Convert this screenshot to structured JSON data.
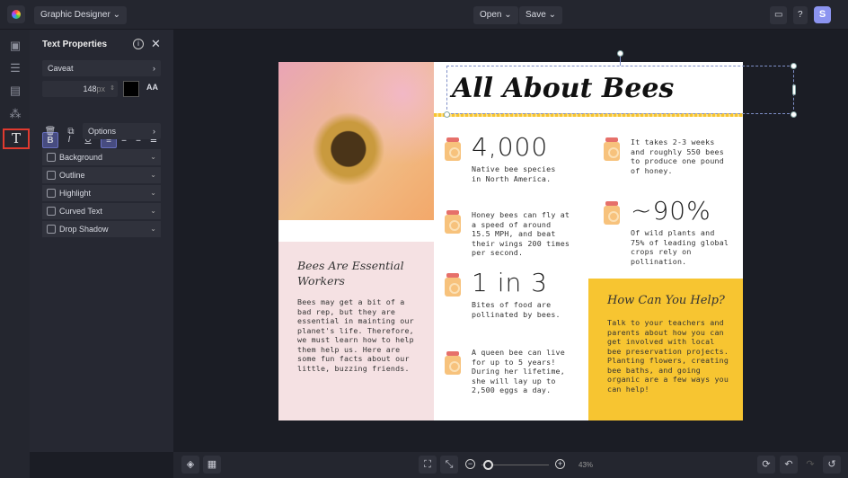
{
  "topbar": {
    "project": "Graphic Designer",
    "open": "Open",
    "save": "Save",
    "avatar": "S"
  },
  "panel": {
    "title": "Text Properties",
    "font": "Caveat",
    "size": "148",
    "unit": "px",
    "options": "Options",
    "accordions": [
      "Background",
      "Outline",
      "Highlight",
      "Curved Text",
      "Drop Shadow"
    ]
  },
  "design": {
    "title": "All About Bees",
    "stats": [
      {
        "big": "4,000",
        "text": "Native bee species in North America."
      },
      {
        "big": "",
        "text": "It takes 2-3 weeks and roughly 550 bees to produce one pound of honey."
      },
      {
        "big": "",
        "text": "Honey bees can fly at a speed of around 15.5 MPH, and beat their wings 200 times per second."
      },
      {
        "big": "~90%",
        "text": "Of wild plants and 75% of leading global crops rely on pollination."
      },
      {
        "big": "1 in 3",
        "text": "Bites of food are pollinated by bees."
      },
      {
        "big": "",
        "text": "A queen bee can live for up to 5 years! During her lifetime, she will lay up to 2,500 eggs a day."
      }
    ],
    "pink": {
      "heading": "Bees Are Essential Workers",
      "body": "Bees may get a bit of a bad rep, but they are essential in mainting our planet's life. Therefore, we must learn how to help them help us. Here are some fun facts about our little, buzzing friends."
    },
    "yellow": {
      "heading": "How Can You Help?",
      "body": "Talk to your teachers and parents about how you can get involved with local bee preservation projects. Planting flowers, creating bee baths, and going organic are a few ways you can help!"
    }
  },
  "bottom": {
    "zoom": "43%",
    "zoom_slider": 0.1
  },
  "colors": {
    "accent": "#7b83eb",
    "yellow": "#f7c531",
    "pink": "#f5e1e3"
  }
}
